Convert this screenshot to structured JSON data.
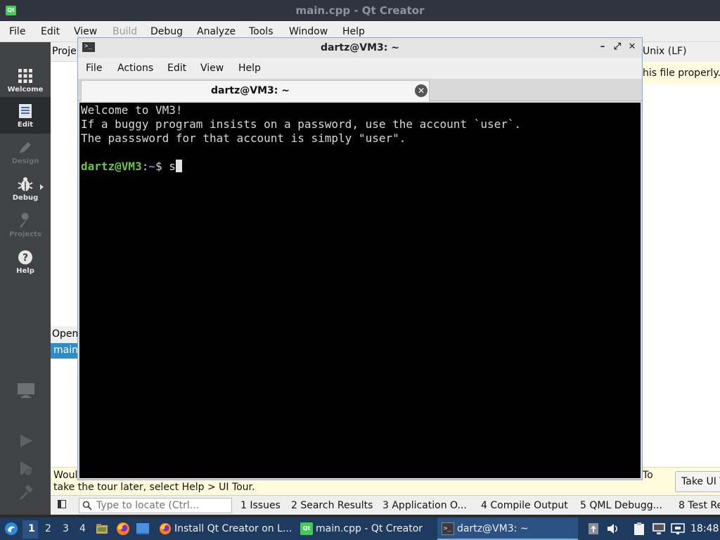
{
  "qt": {
    "title": "main.cpp - Qt Creator",
    "app_icon": "Qt",
    "menu": [
      "File",
      "Edit",
      "View",
      "Build",
      "Debug",
      "Analyze",
      "Tools",
      "Window",
      "Help"
    ],
    "modes": [
      "Welcome",
      "Edit",
      "Design",
      "Debug",
      "Projects",
      "Help"
    ],
    "projects_header": "Proje",
    "line_ending": "Unix (LF)",
    "info_text": "his file properly.",
    "open_documents_header": "Open",
    "open_document_item": "main",
    "tour_line1": "Woul",
    "tour_line2": "take the tour later, select Help > UI Tour.",
    "tour_line3": "To",
    "tour_button": "Take UI T",
    "locator_placeholder": "Type to locate (Ctrl...",
    "output_panes": [
      "1  Issues",
      "2  Search Results",
      "3  Application O...",
      "4  Compile Output",
      "5  QML Debugg...",
      "8  Test Re"
    ]
  },
  "terminal": {
    "title": "dartz@VM3: ~",
    "menu": [
      "File",
      "Actions",
      "Edit",
      "View",
      "Help"
    ],
    "tab_title": "dartz@VM3: ~",
    "lines": [
      "Welcome to VM3!",
      "If a buggy program insists on a password, use the account `user`.",
      "The passsword for that account is simply \"user\"."
    ],
    "prompt_user": "dartz@VM3",
    "prompt_sep": ":",
    "prompt_path": "~",
    "prompt_dollar": "$ ",
    "command": "s"
  },
  "taskbar": {
    "workspaces": [
      "1",
      "2",
      "3",
      "4"
    ],
    "tasks": [
      "Install Qt Creator on L...",
      "main.cpp - Qt Creator",
      "dartz@VM3: ~"
    ],
    "clock": "18:48"
  }
}
